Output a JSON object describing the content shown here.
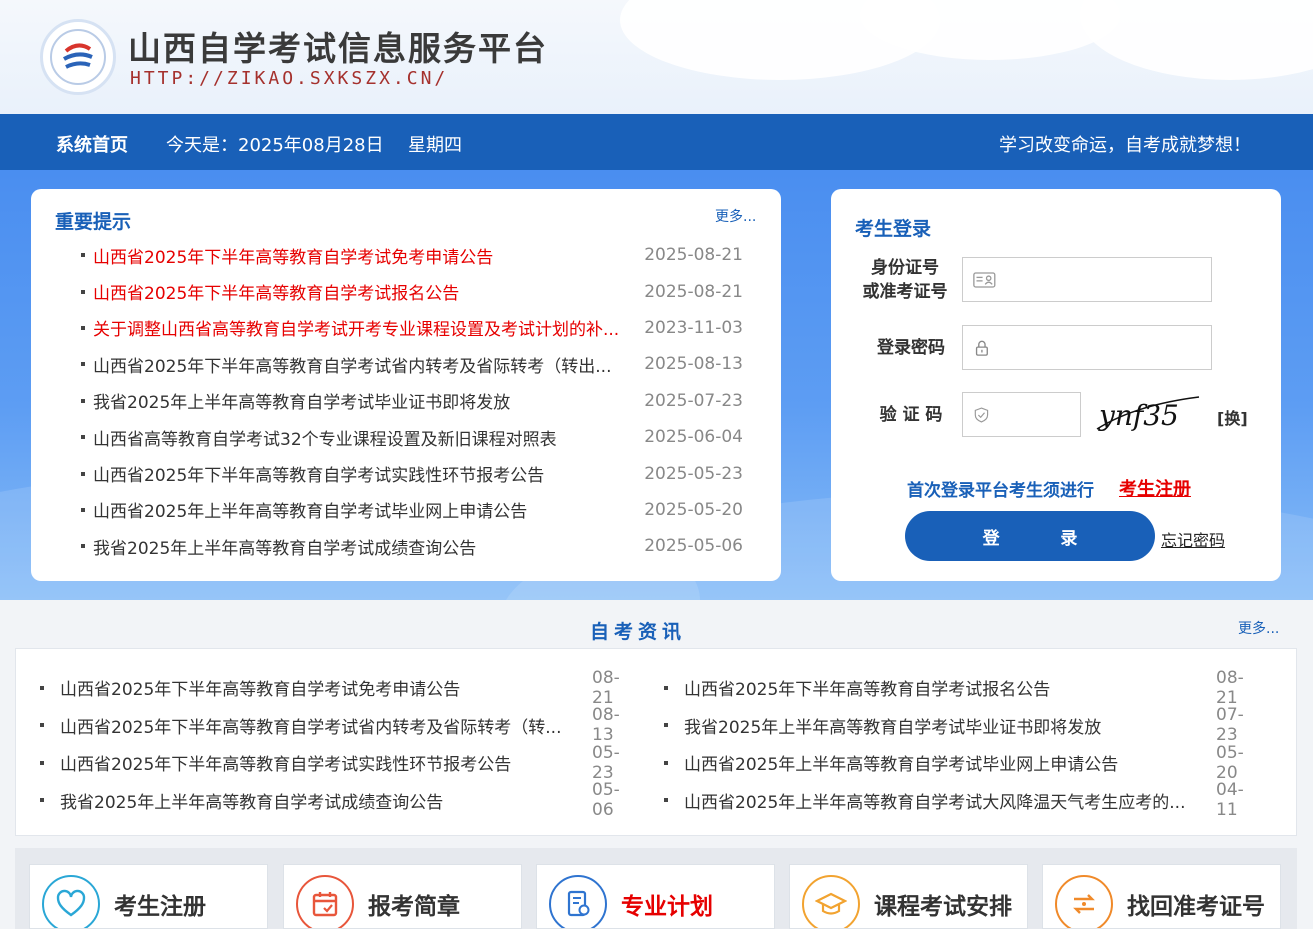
{
  "header": {
    "title": "山西自学考试信息服务平台",
    "url": "HTTP://ZIKAO.SXKSZX.CN/"
  },
  "nav": {
    "home": "系统首页",
    "today": "今天是：2025年08月28日",
    "weekday": "星期四",
    "slogan": "学习改变命运，自考成就梦想！"
  },
  "notices": {
    "title": "重要提示",
    "more": "更多...",
    "items": [
      {
        "text": "山西省2025年下半年高等教育自学考试免考申请公告",
        "date": "2025-08-21",
        "highlight": true
      },
      {
        "text": "山西省2025年下半年高等教育自学考试报名公告",
        "date": "2025-08-21",
        "highlight": true
      },
      {
        "text": "关于调整山西省高等教育自学考试开考专业课程设置及考试计划的补...",
        "date": "2023-11-03",
        "highlight": true
      },
      {
        "text": "山西省2025年下半年高等教育自学考试省内转考及省际转考（转出...",
        "date": "2025-08-13",
        "highlight": false
      },
      {
        "text": "我省2025年上半年高等教育自学考试毕业证书即将发放",
        "date": "2025-07-23",
        "highlight": false
      },
      {
        "text": "山西省高等教育自学考试32个专业课程设置及新旧课程对照表",
        "date": "2025-06-04",
        "highlight": false
      },
      {
        "text": "山西省2025年下半年高等教育自学考试实践性环节报考公告",
        "date": "2025-05-23",
        "highlight": false
      },
      {
        "text": "山西省2025年上半年高等教育自学考试毕业网上申请公告",
        "date": "2025-05-20",
        "highlight": false
      },
      {
        "text": "我省2025年上半年高等教育自学考试成绩查询公告",
        "date": "2025-05-06",
        "highlight": false
      }
    ]
  },
  "login": {
    "title": "考生登录",
    "id_label_1": "身份证号",
    "id_label_2": "或准考证号",
    "password_label": "登录密码",
    "captcha_label": "验 证 码",
    "captcha_text": "ynf35",
    "change": "[换]",
    "first_login": "首次登录平台考生须进行",
    "register_link": "考生注册",
    "submit": "登 录",
    "forgot": "忘记密码"
  },
  "news": {
    "title": "自考资讯",
    "more": "更多...",
    "left": [
      {
        "text": "山西省2025年下半年高等教育自学考试免考申请公告",
        "date": "08-21"
      },
      {
        "text": "山西省2025年下半年高等教育自学考试省内转考及省际转考（转...",
        "date": "08-13"
      },
      {
        "text": "山西省2025年下半年高等教育自学考试实践性环节报考公告",
        "date": "05-23"
      },
      {
        "text": "我省2025年上半年高等教育自学考试成绩查询公告",
        "date": "05-06"
      }
    ],
    "right": [
      {
        "text": "山西省2025年下半年高等教育自学考试报名公告",
        "date": "08-21"
      },
      {
        "text": "我省2025年上半年高等教育自学考试毕业证书即将发放",
        "date": "07-23"
      },
      {
        "text": "山西省2025年上半年高等教育自学考试毕业网上申请公告",
        "date": "05-20"
      },
      {
        "text": "山西省2025年上半年高等教育自学考试大风降温天气考生应考的...",
        "date": "04-11"
      }
    ]
  },
  "shortcuts": [
    {
      "label": "考生注册",
      "icon": "heart-icon",
      "color": "#2aa7d6",
      "highlight": false
    },
    {
      "label": "报考简章",
      "icon": "calendar-icon",
      "color": "#e8563b",
      "highlight": false
    },
    {
      "label": "专业计划",
      "icon": "document-icon",
      "color": "#2f74d0",
      "highlight": true
    },
    {
      "label": "课程考试安排",
      "icon": "graduation-cap-icon",
      "color": "#f2a330",
      "highlight": false
    },
    {
      "label": "找回准考证号",
      "icon": "exchange-icon",
      "color": "#f08a2a",
      "highlight": false
    }
  ]
}
